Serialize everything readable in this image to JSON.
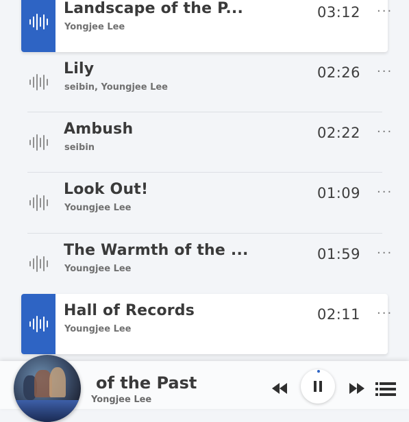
{
  "tracks": [
    {
      "title": "Landscape of the P...",
      "artist": "Yongjee Lee",
      "duration": "03:12",
      "active": true
    },
    {
      "title": "Lily",
      "artist": "seibin, Youngjee Lee",
      "duration": "02:26",
      "active": false
    },
    {
      "title": "Ambush",
      "artist": "seibin",
      "duration": "02:22",
      "active": false
    },
    {
      "title": "Look Out!",
      "artist": "Youngjee Lee",
      "duration": "01:09",
      "active": false
    },
    {
      "title": "The Warmth of the ...",
      "artist": "Youngjee Lee",
      "duration": "01:59",
      "active": false
    },
    {
      "title": "Hall of Records",
      "artist": "Youngjee Lee",
      "duration": "02:11",
      "active": true
    }
  ],
  "more_label": "···",
  "player": {
    "now_playing_title": "of the Past",
    "now_playing_artist": "Yongjee Lee"
  },
  "colors": {
    "accent": "#2e64c4",
    "background": "#f3f5f8"
  },
  "icons": {
    "track": "waveform-icon",
    "more": "more-options-icon",
    "prev": "previous-icon",
    "pause": "pause-icon",
    "next": "next-icon",
    "queue": "playlist-icon"
  }
}
